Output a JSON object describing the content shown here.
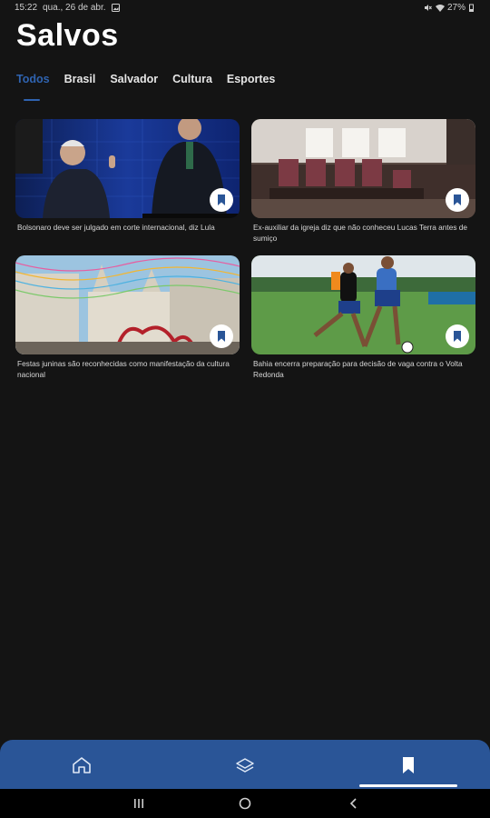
{
  "status_bar": {
    "time": "15:22",
    "date": "qua., 26 de abr.",
    "battery": "27%",
    "icons": [
      "gallery-icon",
      "mute-icon",
      "wifi-icon",
      "battery-icon"
    ]
  },
  "page": {
    "title": "Salvos"
  },
  "tabs": [
    {
      "label": "Todos",
      "active": true
    },
    {
      "label": "Brasil",
      "active": false
    },
    {
      "label": "Salvador",
      "active": false
    },
    {
      "label": "Cultura",
      "active": false
    },
    {
      "label": "Esportes",
      "active": false
    }
  ],
  "articles": [
    {
      "title": "Bolsonaro deve ser julgado em corte internacional, diz Lula",
      "image": "debate-photo",
      "saved": true
    },
    {
      "title": "Ex-auxiliar da igreja diz que não conheceu Lucas Terra antes de sumiço",
      "image": "church-interior-photo",
      "saved": true
    },
    {
      "title": "Festas juninas são reconhecidas como manifestação da cultura nacional",
      "image": "festa-street-photo",
      "saved": true
    },
    {
      "title": "Bahia encerra preparação para decisão de vaga contra o Volta Redonda",
      "image": "football-training-photo",
      "saved": true
    }
  ],
  "bottom_nav": {
    "items": [
      "home-icon",
      "layers-icon",
      "bookmark-icon"
    ],
    "active": "bookmark-icon",
    "colors": {
      "background": "#2a5597",
      "accent": "#2f63b0"
    }
  },
  "system_nav": {
    "buttons": [
      "recents-icon",
      "home-circle-icon",
      "back-icon"
    ]
  }
}
